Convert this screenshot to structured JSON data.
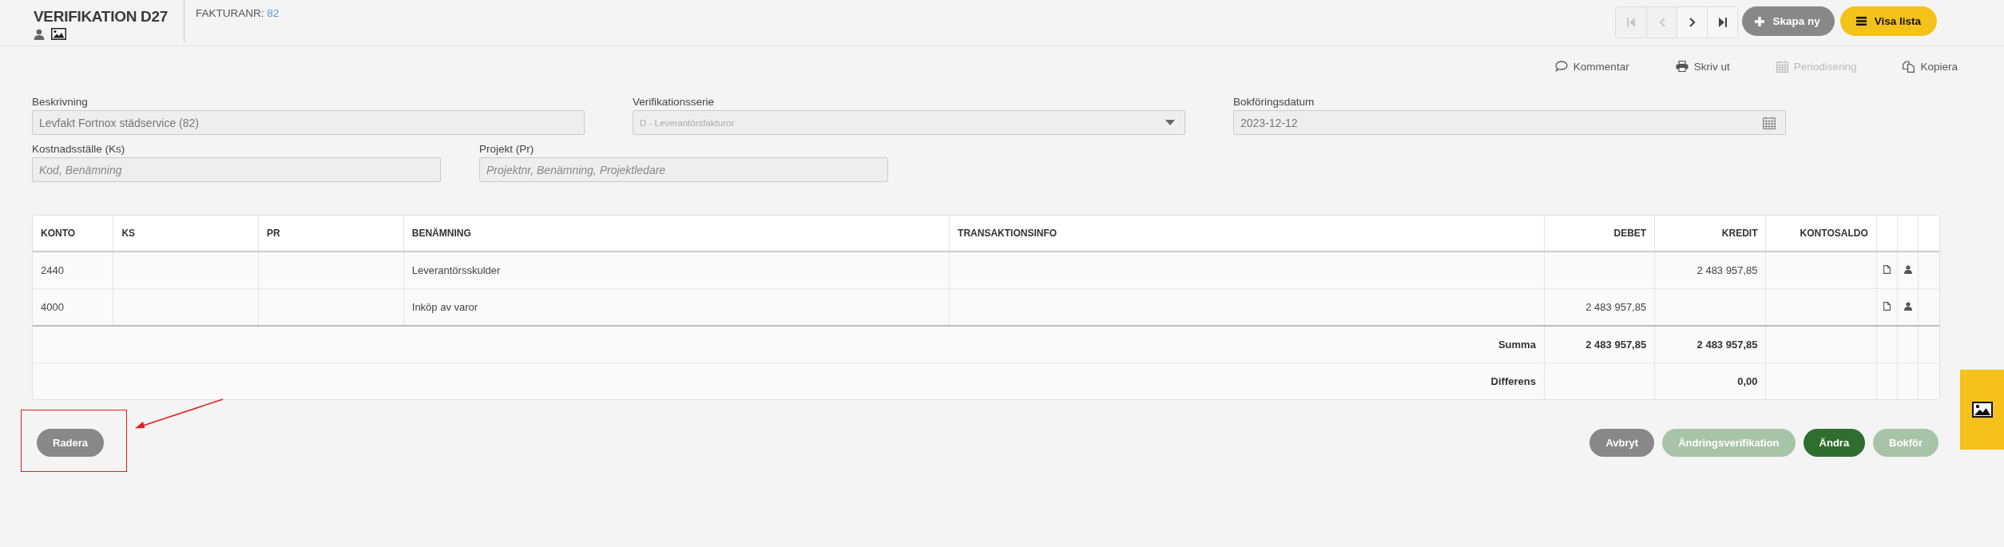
{
  "header": {
    "title": "VERIFIKATION D27",
    "invoice_label": "FAKTURANR:",
    "invoice_number": "82"
  },
  "nav_buttons": [
    {
      "kind": "first",
      "disabled": true
    },
    {
      "kind": "prev",
      "disabled": true
    },
    {
      "kind": "next",
      "disabled": false
    },
    {
      "kind": "last",
      "disabled": false
    }
  ],
  "primary_actions": [
    {
      "kind": "add",
      "label": "Skapa ny"
    },
    {
      "kind": "list",
      "label": "Visa lista"
    }
  ],
  "toolbar": [
    {
      "kind": "comment",
      "label": "Kommentar",
      "disabled": false
    },
    {
      "kind": "print",
      "label": "Skriv ut",
      "disabled": false
    },
    {
      "kind": "calendar",
      "label": "Periodisering",
      "disabled": true
    },
    {
      "kind": "copy",
      "label": "Kopiera",
      "disabled": false
    }
  ],
  "form_rows": [
    [
      {
        "kind": "text",
        "label": "Beskrivning",
        "value": "Levfakt Fortnox städservice (82)",
        "disabled": false
      },
      {
        "kind": "select",
        "label": "Verifikationsserie",
        "value": "D - Leverantörsfakturor",
        "disabled": true
      },
      {
        "kind": "date",
        "label": "Bokföringsdatum",
        "value": "2023-12-12",
        "disabled": false
      }
    ],
    [
      {
        "kind": "text",
        "label": "Kostnadsställe (Ks)",
        "placeholder": "Kod, Benämning"
      },
      {
        "kind": "text",
        "label": "Projekt (Pr)",
        "placeholder": "Projektnr, Benämning, Projektledare"
      }
    ]
  ],
  "table": {
    "columns": [
      {
        "label": "KONTO",
        "kind": "text"
      },
      {
        "label": "KS",
        "kind": "text"
      },
      {
        "label": "PR",
        "kind": "text"
      },
      {
        "label": "BENÄMNING",
        "kind": "text"
      },
      {
        "label": "TRANSAKTIONSINFO",
        "kind": "text"
      },
      {
        "label": "DEBET",
        "kind": "amount"
      },
      {
        "label": "KREDIT",
        "kind": "amount"
      },
      {
        "label": "KONTOSALDO",
        "kind": "amount"
      }
    ],
    "rows": [
      {
        "cells": [
          "2440",
          "",
          "",
          "Leverantörsskulder",
          "",
          "",
          "2 483 957,85",
          ""
        ]
      },
      {
        "cells": [
          "4000",
          "",
          "",
          "Inköp av varor",
          "",
          "2 483 957,85",
          "",
          ""
        ]
      }
    ],
    "totals": [
      {
        "label": "Summa",
        "debet": "2 483 957,85",
        "kredit": "2 483 957,85"
      },
      {
        "label": "Differens",
        "kredit": "0,00"
      }
    ]
  },
  "delete_button": "Radera",
  "footer_actions": [
    {
      "kind": "neutral",
      "label": "Avbryt",
      "disabled": false
    },
    {
      "kind": "light",
      "label": "Ändringsverifikation",
      "disabled": true
    },
    {
      "kind": "primary",
      "label": "Ändra",
      "disabled": false
    },
    {
      "kind": "light",
      "label": "Bokför",
      "disabled": true
    }
  ]
}
